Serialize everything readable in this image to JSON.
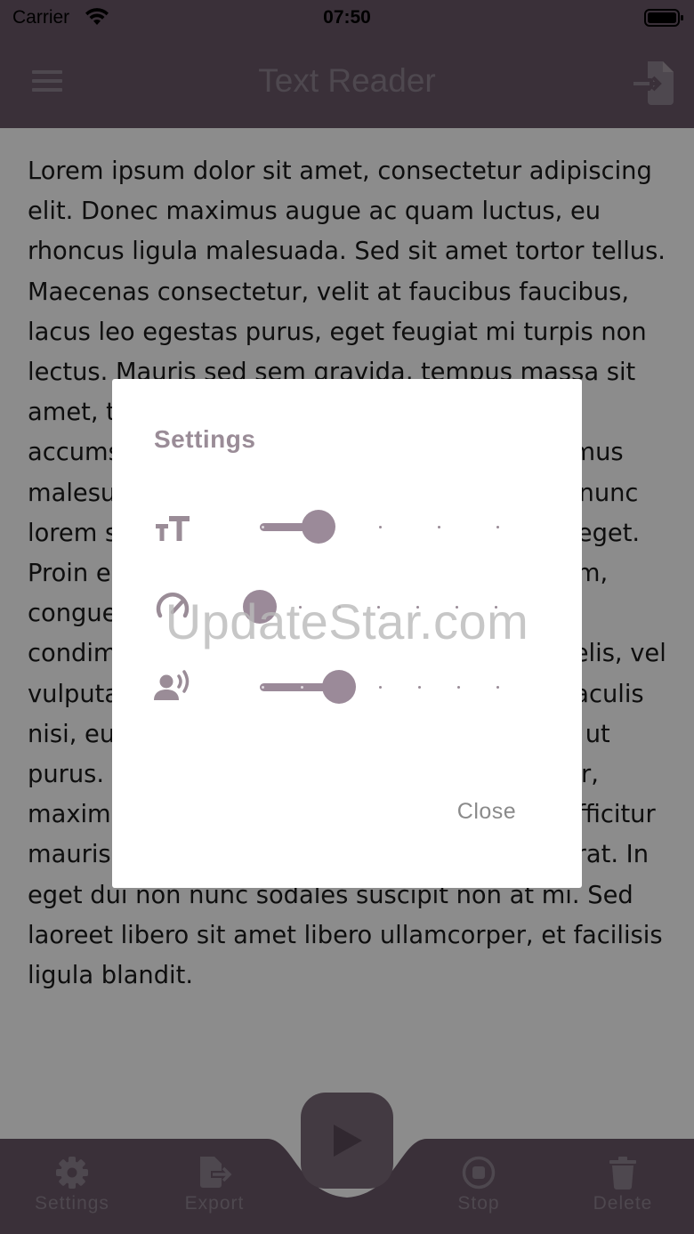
{
  "status_bar": {
    "carrier": "Carrier",
    "time": "07:50"
  },
  "app_bar": {
    "title": "Text Reader",
    "menu_icon": "hamburger-menu-icon",
    "import_icon": "file-import-icon"
  },
  "reader": {
    "text": "Lorem ipsum dolor sit amet, consectetur adipiscing elit. Donec maximus augue ac quam luctus, eu rhoncus ligula malesuada. Sed sit amet tortor tellus. Maecenas consectetur, velit at faucibus faucibus, lacus leo egestas purus, eget feugiat mi turpis non lectus. Mauris sed sem gravida, tempus massa sit amet, tristique augue. Proin eget dolor a leo accumsan vestibulum in suscipit lectus. Vivamus malesuada, lorem vehicula molestie sagittis, nunc lorem scelerisque velit, sit amet consectetur eget. Proin eget magna sit amet est ornare interdum, congue neque. Etiam malesuada, lorem at condimentum sodales, ligula lectus sodales felis, vel vulputate elementum vitae. Pellentesque in iaculis nisi, eu aliquam lectus. Nullam semper tortor ut purus. Suspendisse potenti. Integer est auctor, maximus justo id, malesuada nulla. Integer efficitur mauris nec libero porttitor accumsan et vel erat. In eget dui non nunc sodales suscipit non at mi. Sed laoreet libero sit amet libero ullamcorper, et facilisis ligula blandit."
  },
  "bottom_nav": {
    "items": [
      {
        "label": "Settings",
        "icon": "gear-icon"
      },
      {
        "label": "Export",
        "icon": "file-export-icon"
      },
      {
        "label": "Stop",
        "icon": "stop-circle-icon"
      },
      {
        "label": "Delete",
        "icon": "trash-icon"
      }
    ],
    "play_icon": "play-icon"
  },
  "settings_dialog": {
    "title": "Settings",
    "rows": [
      {
        "name": "font-size",
        "icon": "text-size-icon",
        "value_step": 1,
        "steps": 4
      },
      {
        "name": "speech-rate",
        "icon": "speedometer-icon",
        "value_step": 0,
        "steps": 7
      },
      {
        "name": "pitch",
        "icon": "voice-icon",
        "value_step": 2,
        "steps": 6
      }
    ],
    "close_label": "Close"
  },
  "watermark": "UpdateStar.com",
  "colors": {
    "primary": "#6a5868",
    "accent": "#9b8a99",
    "icon_muted": "#8f8390"
  }
}
